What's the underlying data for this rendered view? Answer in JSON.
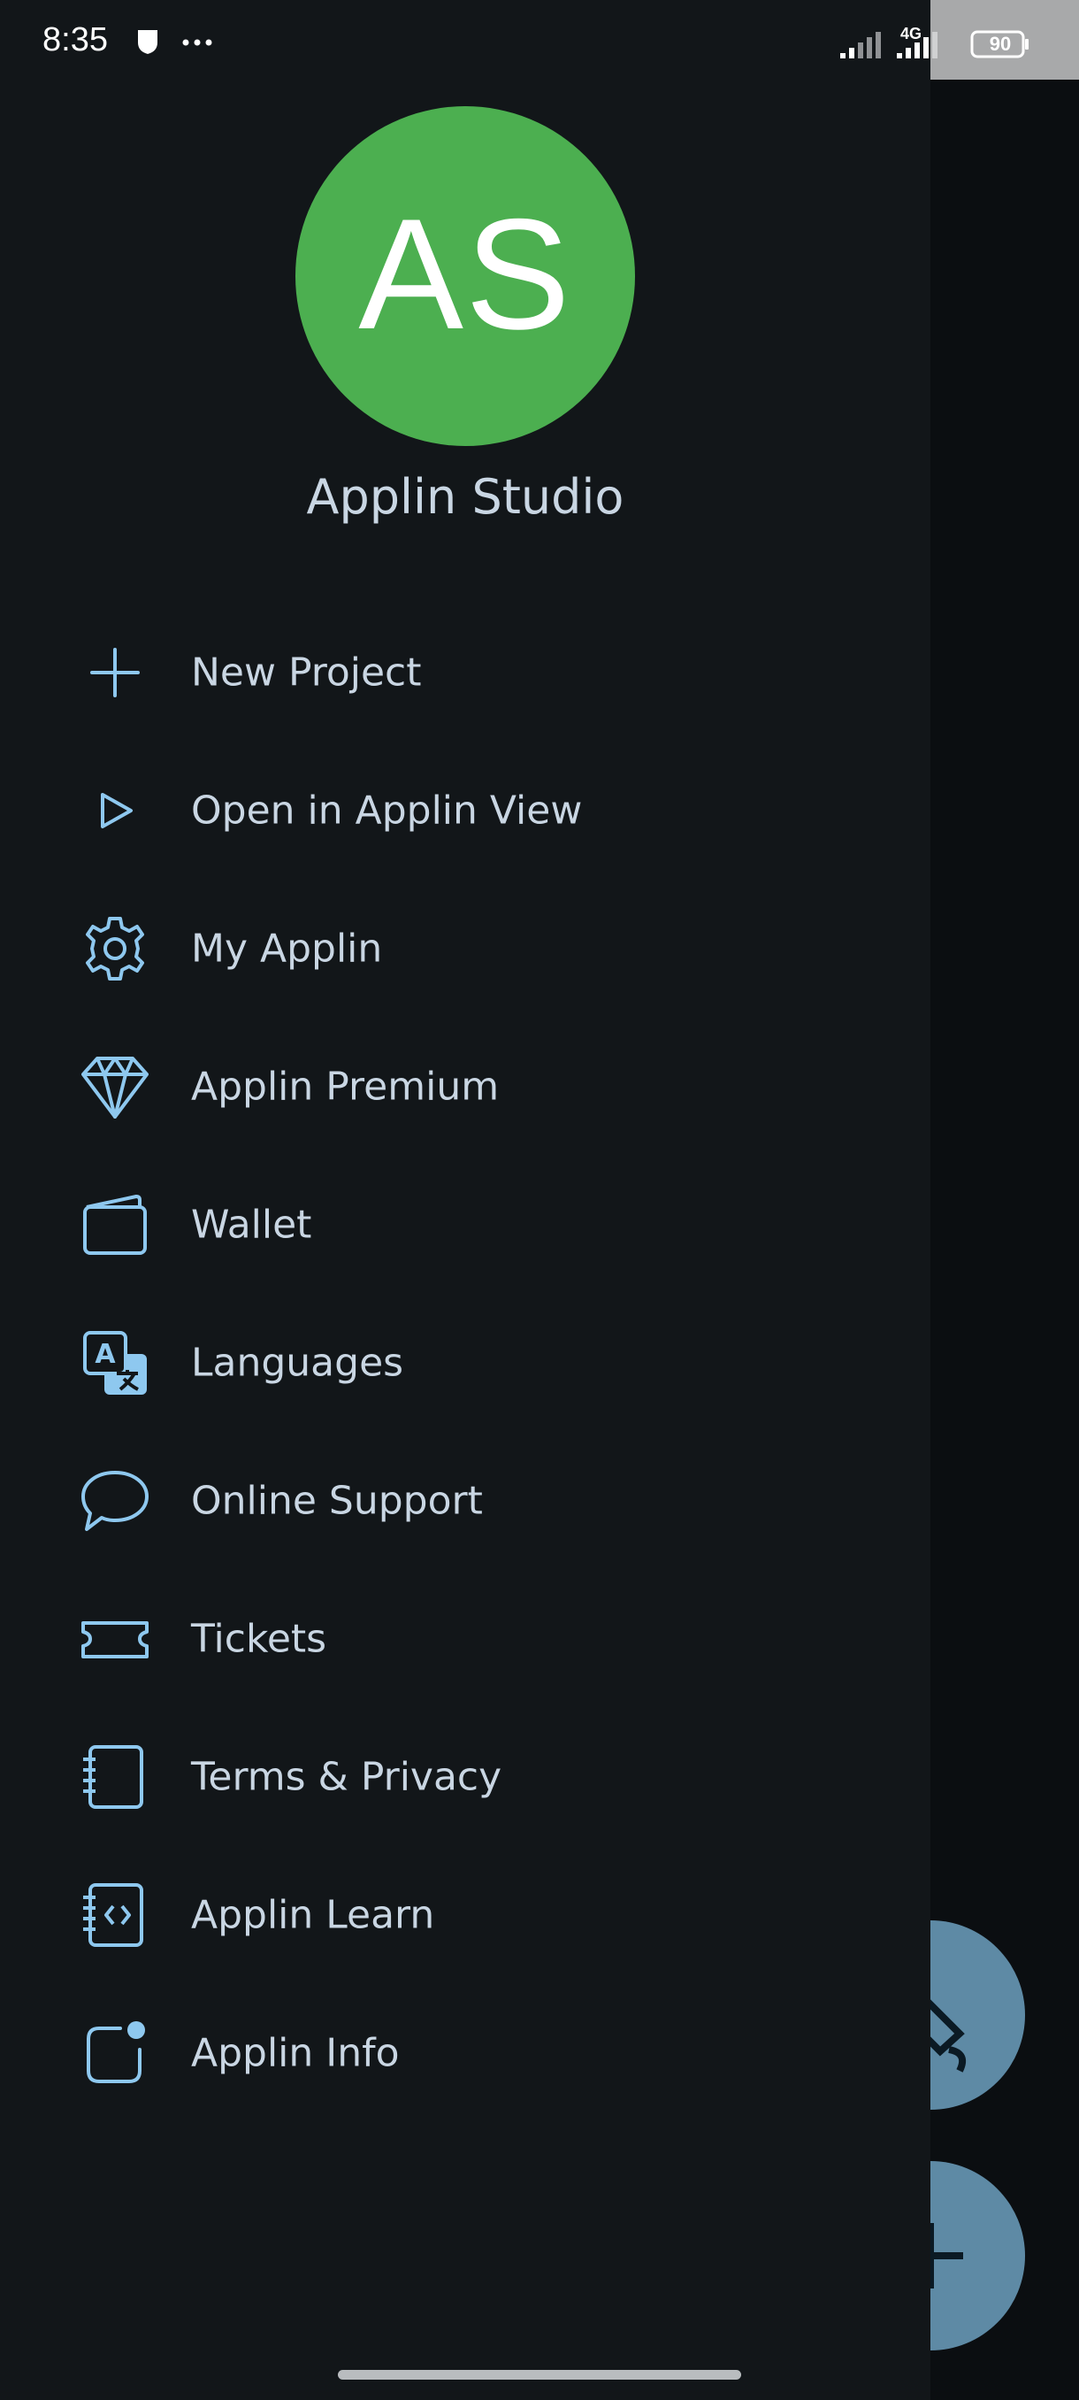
{
  "status_bar": {
    "time": "8:35",
    "network": "4G",
    "battery": "90"
  },
  "profile": {
    "initials": "AS",
    "name": "Applin Studio",
    "avatar_color": "#4caf50"
  },
  "menu": [
    {
      "label": "New Project",
      "icon": "plus-icon"
    },
    {
      "label": "Open in Applin View",
      "icon": "play-icon"
    },
    {
      "label": "My Applin",
      "icon": "gear-icon"
    },
    {
      "label": "Applin Premium",
      "icon": "diamond-icon"
    },
    {
      "label": "Wallet",
      "icon": "wallet-icon"
    },
    {
      "label": "Languages",
      "icon": "translate-icon"
    },
    {
      "label": "Online Support",
      "icon": "chat-bubble-icon"
    },
    {
      "label": "Tickets",
      "icon": "ticket-icon"
    },
    {
      "label": "Terms & Privacy",
      "icon": "notebook-icon"
    },
    {
      "label": "Applin Learn",
      "icon": "code-notebook-icon"
    },
    {
      "label": "Applin Info",
      "icon": "notification-app-icon"
    }
  ],
  "colors": {
    "drawer_bg": "#121619",
    "icon": "#8ec8ef",
    "text": "#c9d6e3",
    "fab": "#5e8aa5"
  }
}
